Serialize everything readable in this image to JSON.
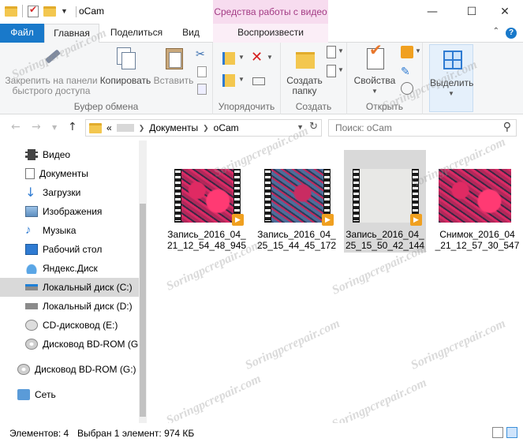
{
  "window": {
    "title": "oCam",
    "context_tab_header": "Средства работы с видео",
    "controls": {
      "minimize": "—",
      "maximize": "☐",
      "close": "✕"
    }
  },
  "ribbon_tabs": {
    "file": "Файл",
    "home": "Главная",
    "share": "Поделиться",
    "view": "Вид",
    "play": "Воспроизвести",
    "help": "?",
    "collapse": "⌃"
  },
  "ribbon": {
    "clipboard": {
      "pin": "Закрепить на панели быстрого доступа",
      "copy": "Копировать",
      "paste": "Вставить",
      "label": "Буфер обмена"
    },
    "organize": {
      "label": "Упорядочить"
    },
    "create": {
      "new_folder": "Создать папку",
      "label": "Создать"
    },
    "open": {
      "properties": "Свойства",
      "label": "Открыть"
    },
    "select": {
      "select": "Выделить"
    }
  },
  "address": {
    "crumbs": [
      "«",
      "Документы",
      "oCam"
    ],
    "search_placeholder": "Поиск: oCam"
  },
  "nav": {
    "items": [
      {
        "label": "Видео",
        "icon": "video-icon"
      },
      {
        "label": "Документы",
        "icon": "documents-icon"
      },
      {
        "label": "Загрузки",
        "icon": "downloads-icon"
      },
      {
        "label": "Изображения",
        "icon": "pictures-icon"
      },
      {
        "label": "Музыка",
        "icon": "music-icon"
      },
      {
        "label": "Рабочий стол",
        "icon": "desktop-icon"
      },
      {
        "label": "Яндекс.Диск",
        "icon": "yandex-disk-icon"
      },
      {
        "label": "Локальный диск (C:)",
        "icon": "drive-icon",
        "selected": true
      },
      {
        "label": "Локальный диск (D:)",
        "icon": "drive-icon"
      },
      {
        "label": "CD-дисковод (E:)",
        "icon": "cd-drive-icon"
      },
      {
        "label": "Дисковод BD-ROM (G:)",
        "icon": "disc-icon"
      },
      {
        "label": "Дисковод BD-ROM (G:) F",
        "icon": "disc-icon"
      },
      {
        "label": "Сеть",
        "icon": "network-icon"
      }
    ]
  },
  "files": [
    {
      "line1": "Запись_2016_04_",
      "line2": "21_12_54_48_945",
      "kind": "video",
      "selected": false
    },
    {
      "line1": "Запись_2016_04_",
      "line2": "25_15_44_45_172",
      "kind": "video",
      "selected": false
    },
    {
      "line1": "Запись_2016_04_",
      "line2": "25_15_50_42_144",
      "kind": "video",
      "selected": true
    },
    {
      "line1": "Снимок_2016_04",
      "line2": "_21_12_57_30_547",
      "kind": "image",
      "selected": false
    }
  ],
  "status": {
    "count": "Элементов: 4",
    "selection": "Выбран 1 элемент: 974 КБ"
  },
  "watermark": "Soringpcrepair.com",
  "colors": {
    "accent": "#1979ca",
    "context_tab": "#a33b84",
    "selection": "#d9d9d9"
  }
}
